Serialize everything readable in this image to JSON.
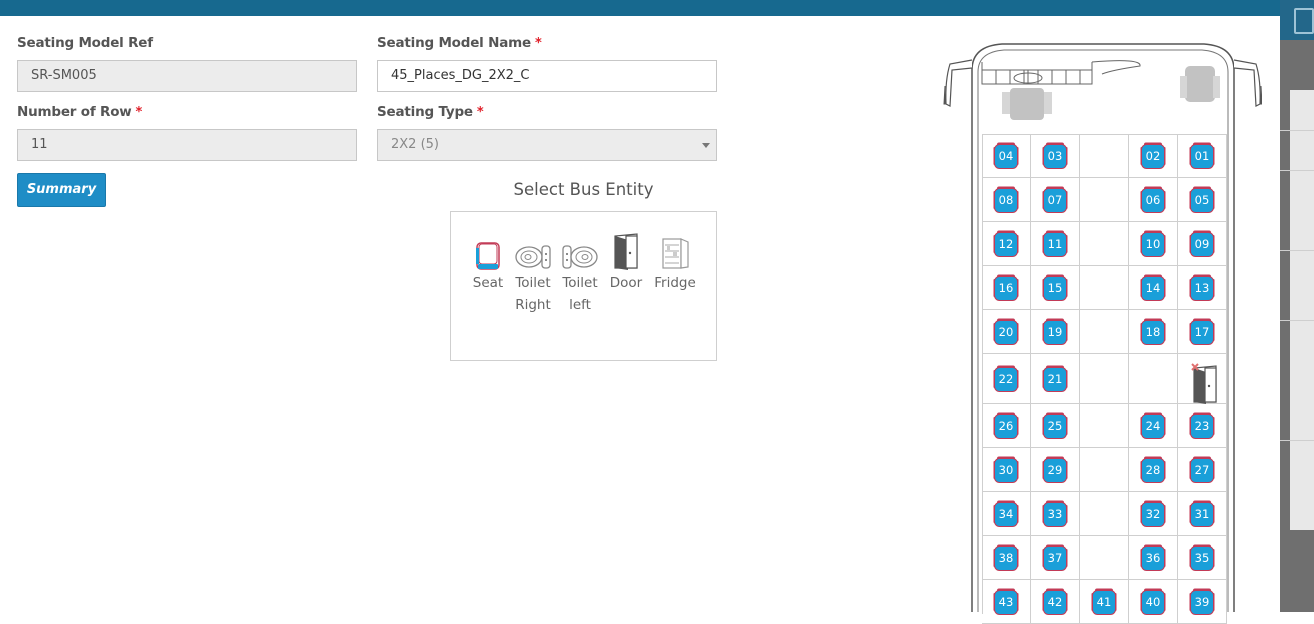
{
  "form": {
    "model_ref_label": "Seating Model Ref",
    "model_ref_value": "SR-SM005",
    "model_name_label": "Seating Model Name",
    "model_name_value": "45_Places_DG_2X2_C",
    "rows_label": "Number of Row",
    "rows_value": "11",
    "seating_type_label": "Seating Type",
    "seating_type_value": "2X2 (5)",
    "required_mark": "*",
    "summary_button": "Summary"
  },
  "entity_panel": {
    "title": "Select Bus Entity",
    "seat": "Seat",
    "toilet_right_1": "Toilet",
    "toilet_right_2": "Right",
    "toilet_left_1": "Toilet",
    "toilet_left_2": "left",
    "door": "Door",
    "fridge": "Fridge"
  },
  "seat_map": {
    "columns": 5,
    "rows": [
      [
        "04",
        "03",
        null,
        "02",
        "01"
      ],
      [
        "08",
        "07",
        null,
        "06",
        "05"
      ],
      [
        "12",
        "11",
        null,
        "10",
        "09"
      ],
      [
        "16",
        "15",
        null,
        "14",
        "13"
      ],
      [
        "20",
        "19",
        null,
        "18",
        "17"
      ],
      [
        "22",
        "21",
        null,
        null,
        "door"
      ],
      [
        "26",
        "25",
        null,
        "24",
        "23"
      ],
      [
        "30",
        "29",
        null,
        "28",
        "27"
      ],
      [
        "34",
        "33",
        null,
        "32",
        "31"
      ],
      [
        "38",
        "37",
        null,
        "36",
        "35"
      ],
      [
        "43",
        "42",
        "41",
        "40",
        "39"
      ]
    ]
  },
  "colors": {
    "header": "#17698f",
    "seat_fill": "#1a9fd9",
    "seat_border": "#c23b57",
    "button": "#1f8dc6"
  }
}
